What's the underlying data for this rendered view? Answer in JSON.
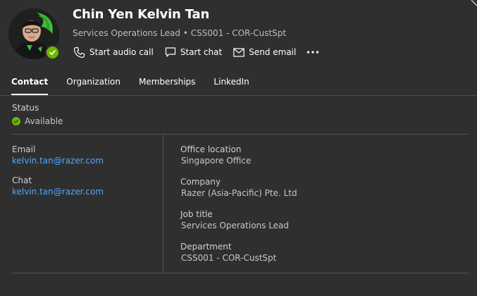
{
  "person": {
    "name": "Chin Yen Kelvin Tan",
    "subtitle": "Services Operations Lead • CSS001 - COR-CustSpt",
    "presence_color": "#6bb700"
  },
  "actions": {
    "audio_call": "Start audio call",
    "chat": "Start chat",
    "email": "Send email",
    "more_icon": "more-horizontal-icon"
  },
  "tabs": [
    {
      "label": "Contact",
      "active": true
    },
    {
      "label": "Organization",
      "active": false
    },
    {
      "label": "Memberships",
      "active": false
    },
    {
      "label": "LinkedIn",
      "active": false
    }
  ],
  "contact": {
    "status_label": "Status",
    "status_value": "Available",
    "email_label": "Email",
    "email_value": "kelvin.tan@razer.com",
    "chat_label": "Chat",
    "chat_value": "kelvin.tan@razer.com",
    "office_label": "Office location",
    "office_value": "Singapore Office",
    "company_label": "Company",
    "company_value": "Razer (Asia-Pacific) Pte. Ltd",
    "job_label": "Job title",
    "job_value": "Services Operations Lead",
    "department_label": "Department",
    "department_value": "CSS001 - COR-CustSpt"
  },
  "colors": {
    "background": "#2f2f2f",
    "link": "#4fa8ff",
    "available": "#6bb700"
  }
}
